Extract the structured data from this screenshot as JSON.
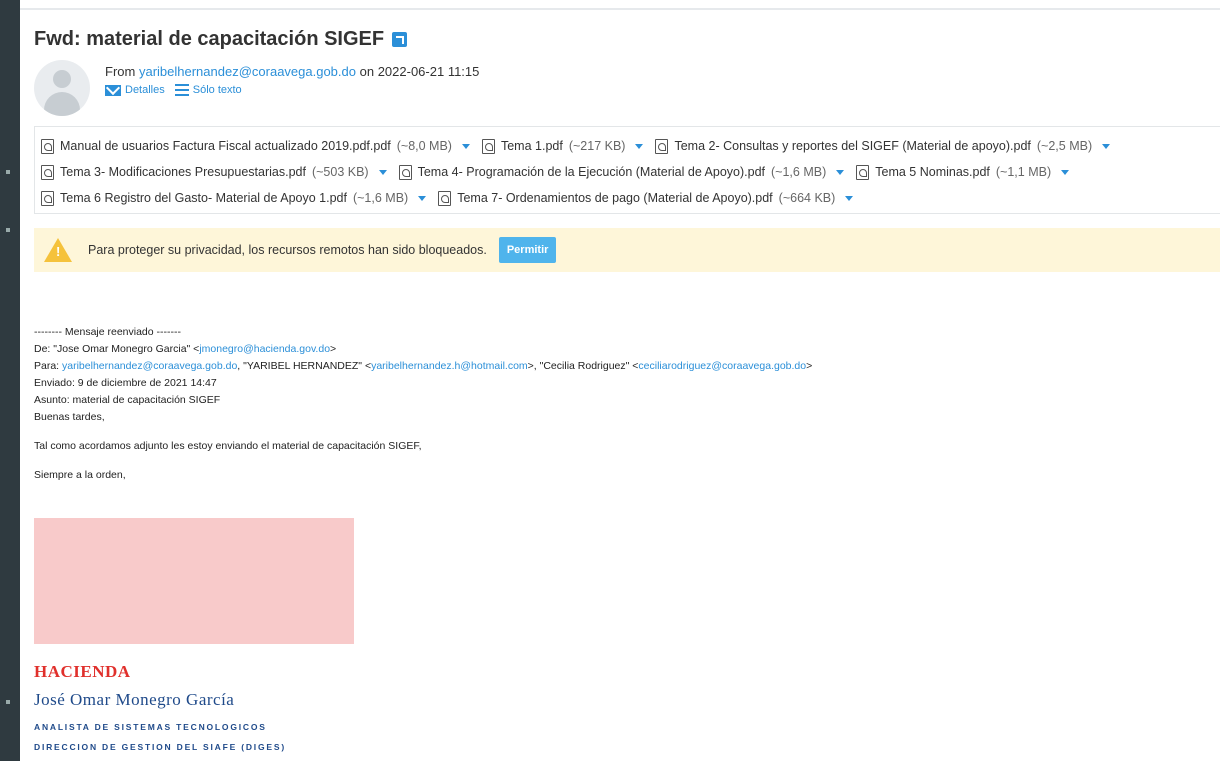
{
  "message": {
    "subject": "Fwd: material de capacitación SIGEF",
    "from_prefix": "From",
    "from_email": "yaribelhernandez@coraavega.gob.do",
    "date_prefix": "on",
    "date": "2022-06-21 11:15",
    "actions": {
      "details": "Detalles",
      "plain_text": "Sólo texto"
    }
  },
  "attachments": [
    [
      {
        "name": "Manual de usuarios Factura Fiscal actualizado 2019.pdf.pdf",
        "size": "(~8,0 MB)"
      },
      {
        "name": "Tema 1.pdf",
        "size": "(~217 KB)"
      },
      {
        "name": "Tema 2- Consultas y reportes del SIGEF (Material de apoyo).pdf",
        "size": "(~2,5 MB)"
      }
    ],
    [
      {
        "name": "Tema 3- Modificaciones Presupuestarias.pdf",
        "size": "(~503 KB)"
      },
      {
        "name": "Tema 4- Programación de la Ejecución (Material de Apoyo).pdf",
        "size": "(~1,6 MB)"
      },
      {
        "name": "Tema 5 Nominas.pdf",
        "size": "(~1,1 MB)"
      }
    ],
    [
      {
        "name": "Tema 6 Registro del Gasto- Material de Apoyo 1.pdf",
        "size": "(~1,6 MB)"
      },
      {
        "name": "Tema 7- Ordenamientos de pago (Material de Apoyo).pdf",
        "size": "(~664 KB)"
      }
    ]
  ],
  "privacy": {
    "text": "Para proteger su privacidad, los recursos remotos han sido bloqueados.",
    "button": "Permitir"
  },
  "forwarded": {
    "separator": "-------- Mensaje reenviado -------",
    "from_label": "De: \"Jose Omar Monegro Garcia\" <",
    "from_email": "jmonegro@hacienda.gov.do",
    "from_close": ">",
    "to_label": "Para: ",
    "to_email1": "yaribelhernandez@coraavega.gob.do",
    "to_mid1": ", \"YARIBEL HERNANDEZ\" <",
    "to_email2": "yaribelhernandez.h@hotmail.com",
    "to_mid2": ">, \"Cecilia Rodriguez\" <",
    "to_email3": "ceciliarodriguez@coraavega.gob.do",
    "to_close": ">",
    "sent": "Enviado: 9 de diciembre de 2021 14:47",
    "subject": "Asunto: material de capacitación SIGEF",
    "greeting": "Buenas tardes,",
    "body": "Tal como acordamos adjunto les estoy enviando el material de capacitación SIGEF,",
    "closing": "Siempre a la orden,"
  },
  "signature": {
    "org": "HACIENDA",
    "name": "José Omar Monegro García",
    "role": "ANALISTA DE SISTEMAS TECNOLOGICOS",
    "dept": "DIRECCION DE GESTION DEL SIAFE (DIGES)"
  },
  "colors": {
    "link": "#2b8fd8",
    "warning_bg": "#fef6d9",
    "button": "#4fb4ec",
    "signature_red": "#e0302c",
    "signature_blue": "#1f4a8a"
  }
}
